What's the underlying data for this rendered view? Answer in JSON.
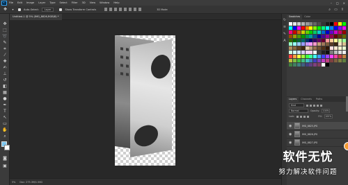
{
  "menubar": {
    "app_logo": "Ps",
    "items": [
      "File",
      "Edit",
      "Image",
      "Layer",
      "Type",
      "Select",
      "Filter",
      "3D",
      "View",
      "Window",
      "Help"
    ]
  },
  "options": {
    "auto_select_label": "Auto-Select:",
    "auto_select_value": "Layer",
    "show_transform_label": "Show Transform Controls",
    "mode_3d_label": "3D Mode:"
  },
  "document": {
    "tab_title": "Untitled-1 @ 5% (IMG_8826,RGB/8) *"
  },
  "status": {
    "zoom": "5%",
    "doc_info": "Doc: 275.3M/1.56G"
  },
  "swatches_panel": {
    "tabs": [
      "Swatches",
      "Color"
    ],
    "colors": [
      "#ffffff",
      "#e6e6e6",
      "#cccccc",
      "#b3b3b3",
      "#999999",
      "#808080",
      "#666666",
      "#4d4d4d",
      "#333333",
      "#1a1a1a",
      "#000000",
      "#ff0000",
      "#ffff00",
      "#00ff00",
      "#00ffff",
      "#0000ff",
      "#ff00ff",
      "#ff0000",
      "#ff8000",
      "#ffff00",
      "#80ff00",
      "#00ff00",
      "#00ff80",
      "#00ffff",
      "#0080ff",
      "#0000ff",
      "#8000ff",
      "#ff00ff",
      "#ff0080",
      "#cc0000",
      "#cc6600",
      "#cccc00",
      "#66cc00",
      "#00cc00",
      "#00cc66",
      "#00cccc",
      "#0066cc",
      "#0000cc",
      "#6600cc",
      "#cc00cc",
      "#cc0066",
      "#990000",
      "#994c00",
      "#999900",
      "#4c9900",
      "#009900",
      "#00994c",
      "#009999",
      "#004c99",
      "#000099",
      "#4c0099",
      "#990099",
      "#99004c",
      "#660000",
      "#663300",
      "#666600",
      "#336600",
      "#006600",
      "#006633",
      "#006666",
      "#003366",
      "#000066",
      "#330066",
      "#660066",
      "#660033",
      "#ff9999",
      "#ffcc99",
      "#ffff99",
      "#ccff99",
      "#99ff99",
      "#99ffcc",
      "#99ffff",
      "#99ccff",
      "#9999ff",
      "#cc99ff",
      "#ff99ff",
      "#ff99cc",
      "#c6a079",
      "#a0785a",
      "#7a5a3c",
      "#5a3c28",
      "#3c2814",
      "#f0e0c0",
      "#d8c090",
      "#b09060",
      "#886840",
      "#604020",
      "#402810",
      "#e8d0b0",
      "#c0a080",
      "#987050",
      "#705030",
      "#503018",
      "#301808",
      "#ffe0e0",
      "#ffe8d0",
      "#fff8d0",
      "#e8ffd0",
      "#d0ffe0",
      "#d0fff8",
      "#d0e8ff",
      "#d8d0ff",
      "#f0d0ff",
      "#ffd0f0",
      "#f8f8f8",
      "#404040",
      "#202020",
      "#101010",
      "#7f7f7f",
      "#bfbfbf",
      "#dfdfdf",
      "#efefef",
      "#ff4040",
      "#ffa040",
      "#ffff40",
      "#a0ff40",
      "#40ff40",
      "#40ffa0",
      "#40ffff",
      "#40a0ff",
      "#4040ff",
      "#a040ff",
      "#ff40ff",
      "#ff40a0",
      "#c04040",
      "#c08040",
      "#c0c040",
      "#80c040",
      "#40c040",
      "#40c080",
      "#40c0c0",
      "#4080c0",
      "#4040c0",
      "#8040c0",
      "#c040c0",
      "#c04080",
      "#804040",
      "#806040",
      "#808040",
      "#608040",
      "#408040",
      "#408060",
      "#408080",
      "#406080",
      "#404080",
      "#604080",
      "#804080",
      "#804060",
      "#ffffff",
      "#000000"
    ]
  },
  "layers_panel": {
    "tabs": [
      "Layers",
      "Channels",
      "Paths"
    ],
    "kind_label": "Kind",
    "blend_mode": "Normal",
    "opacity_label": "Opacity:",
    "opacity_value": "100%",
    "lock_label": "Lock:",
    "fill_label": "Fill:",
    "fill_value": "100%",
    "layers": [
      {
        "name": "IMG_8825.JPG"
      },
      {
        "name": "IMG_8826.JPG"
      },
      {
        "name": "IMG_8827.JPG"
      }
    ]
  },
  "watermark": {
    "main": "软件无忧",
    "sub": "努力解决软件问题"
  },
  "colors": {
    "foreground": "#7cc6ee",
    "background": "#ffffff",
    "accent_button": "#f39c34"
  }
}
